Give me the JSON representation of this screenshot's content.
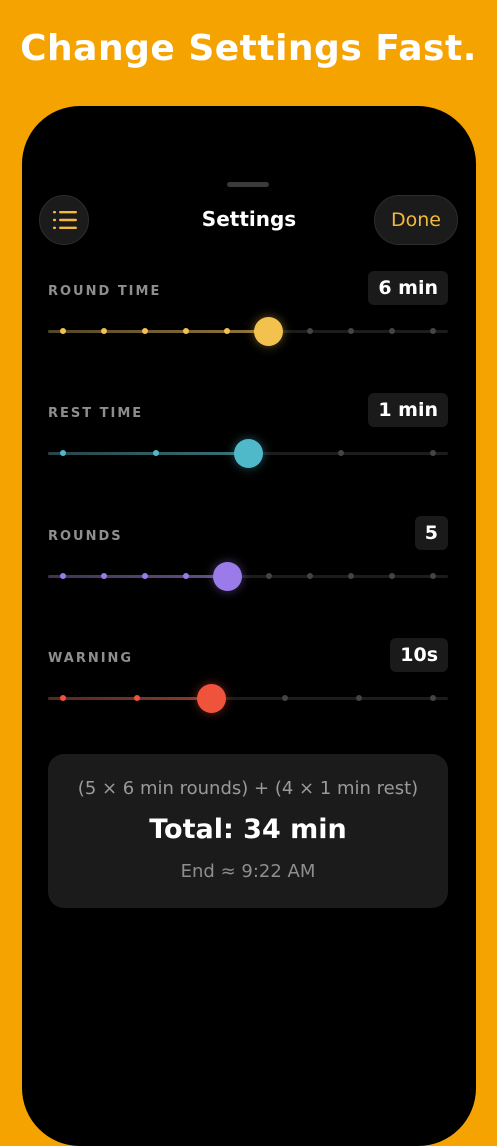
{
  "headline": "Change Settings Fast.",
  "nav": {
    "title": "Settings",
    "done_label": "Done",
    "menu_icon": "list-icon"
  },
  "colors": {
    "background": "#F5A300",
    "accent": "#F2B93B",
    "round": "#F2C14E",
    "rest": "#4FB9C9",
    "rounds": "#9B7BEA",
    "warning": "#F0533B"
  },
  "settings": [
    {
      "id": "round-time",
      "label": "ROUND TIME",
      "value": "6 min",
      "color": "#F2C14E",
      "steps": 10,
      "selected_index": 5
    },
    {
      "id": "rest-time",
      "label": "REST TIME",
      "value": "1 min",
      "color": "#4FB9C9",
      "steps": 5,
      "selected_index": 2
    },
    {
      "id": "rounds",
      "label": "ROUNDS",
      "value": "5",
      "color": "#9B7BEA",
      "steps": 10,
      "selected_index": 4
    },
    {
      "id": "warning",
      "label": "WARNING",
      "value": "10s",
      "color": "#F0533B",
      "steps": 6,
      "selected_index": 2
    }
  ],
  "summary": {
    "formula": "(5 × 6 min rounds) + (4 × 1 min rest)",
    "total": "Total: 34 min",
    "end": "End ≈ 9:22 AM"
  }
}
